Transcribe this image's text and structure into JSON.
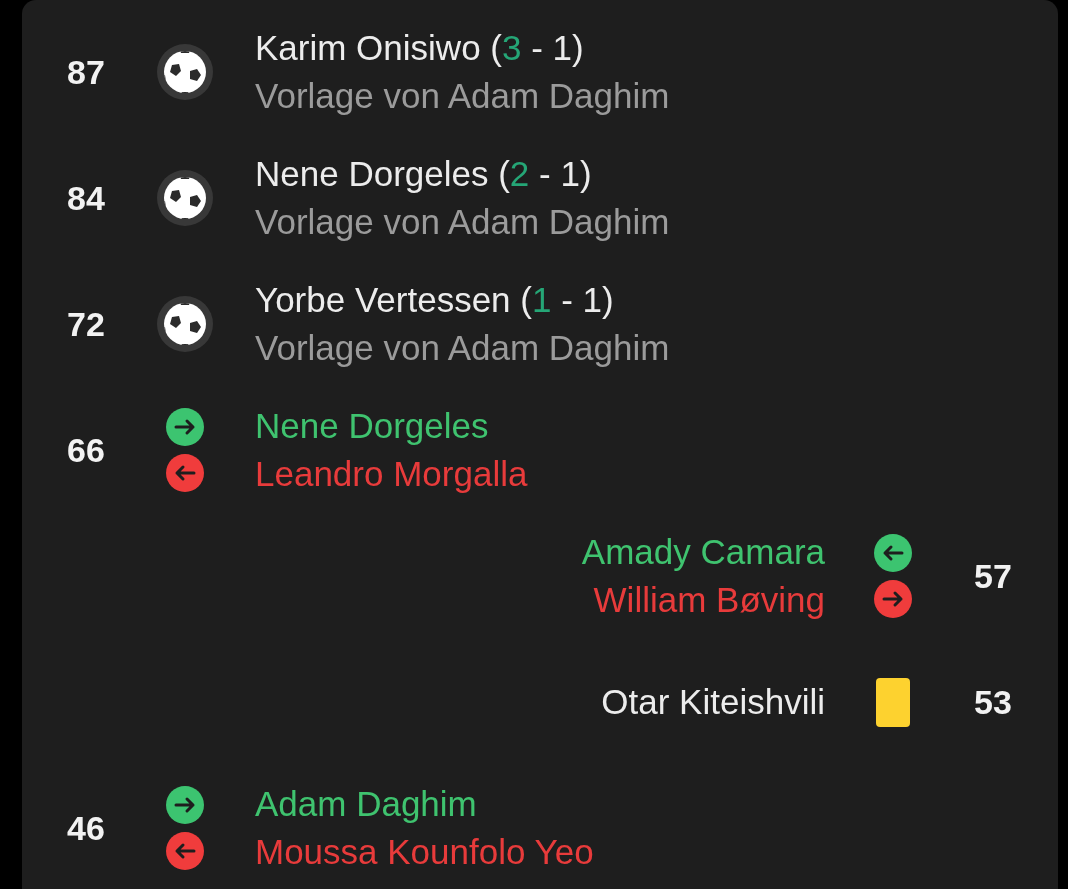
{
  "events": [
    {
      "minute": "87",
      "home_event": {
        "kind": "goal",
        "scorer": "Karim Onisiwo (",
        "home_score": "3",
        "score_tail": " - 1)",
        "assist": "Vorlage von Adam Daghim"
      }
    },
    {
      "minute": "84",
      "home_event": {
        "kind": "goal",
        "scorer": "Nene Dorgeles (",
        "home_score": "2",
        "score_tail": " - 1)",
        "assist": "Vorlage von Adam Daghim"
      }
    },
    {
      "minute": "72",
      "home_event": {
        "kind": "goal",
        "scorer": "Yorbe Vertessen (",
        "home_score": "1",
        "score_tail": " - 1)",
        "assist": "Vorlage von Adam Daghim"
      }
    },
    {
      "minute": "66",
      "home_event": {
        "kind": "substitution",
        "player_in": "Nene Dorgeles",
        "player_out": "Leandro Morgalla"
      }
    },
    {
      "minute": "57",
      "away_event": {
        "kind": "substitution",
        "player_in": "Amady Camara",
        "player_out": "William Bøving"
      }
    },
    {
      "minute": "53",
      "away_event": {
        "kind": "yellow_card",
        "player": "Otar Kiteishvili"
      }
    },
    {
      "minute": "46",
      "home_event": {
        "kind": "substitution",
        "player_in": "Adam Daghim",
        "player_out": "Moussa Kounfolo Yeo"
      }
    }
  ]
}
